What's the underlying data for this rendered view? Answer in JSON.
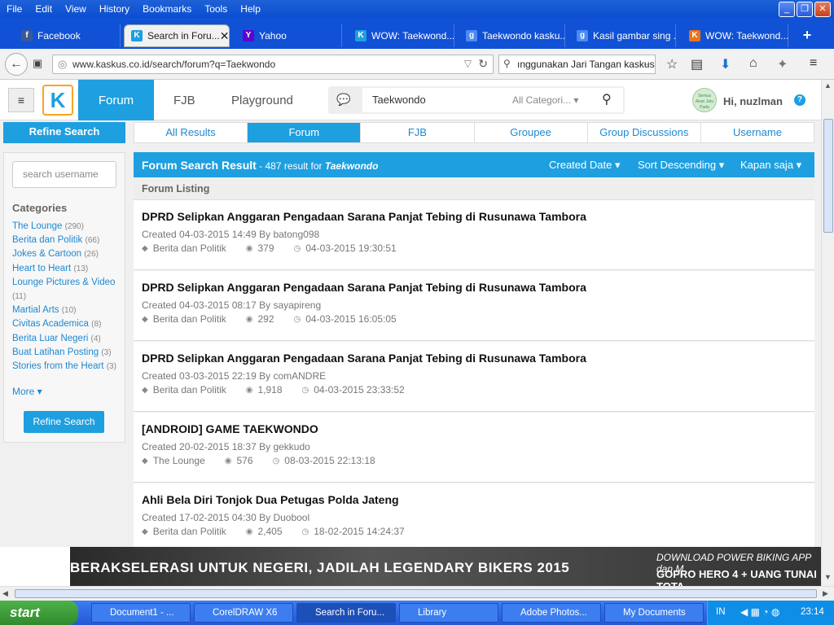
{
  "menubar": [
    "File",
    "Edit",
    "View",
    "History",
    "Bookmarks",
    "Tools",
    "Help"
  ],
  "tabs": [
    {
      "label": "Facebook",
      "icon": "facebook-icon"
    },
    {
      "label": "Search in Foru...",
      "icon": "kaskus-icon"
    },
    {
      "label": "Yahoo",
      "icon": "yahoo-icon"
    },
    {
      "label": "WOW: Taekwond...",
      "icon": "kaskus-icon"
    },
    {
      "label": "Taekwondo kasku...",
      "icon": "google-icon"
    },
    {
      "label": "Kasil gambar sing ...",
      "icon": "google-icon"
    },
    {
      "label": "WOW: Taekwond...",
      "icon": "kaskus-icon"
    }
  ],
  "url": "www.kaskus.co.id/search/forum?q=Taekwondo",
  "browser_search": "ınggunakan Jari Tangan kaskus",
  "header": {
    "nav_forum": "Forum",
    "nav_fjb": "FJB",
    "nav_playground": "Playground",
    "search_value": "Taekwondo",
    "category": "All Categori...",
    "greeting": "Hi, nuzlman",
    "help": "?",
    "avatar_text": "Semua Akan Jatu Pada Waktunya"
  },
  "sidebar": {
    "refine_head": "Refine Search",
    "username_placeholder": "search username",
    "categories_label": "Categories",
    "categories": [
      {
        "name": "The Lounge",
        "count": "(290)"
      },
      {
        "name": "Berita dan Politik",
        "count": "(66)"
      },
      {
        "name": "Jokes & Cartoon",
        "count": "(26)"
      },
      {
        "name": "Heart to Heart",
        "count": "(13)"
      },
      {
        "name": "Lounge Pictures & Video",
        "count": "(11)"
      },
      {
        "name": "Martial Arts",
        "count": "(10)"
      },
      {
        "name": "Civitas Academica",
        "count": "(8)"
      },
      {
        "name": "Berita Luar Negeri",
        "count": "(4)"
      },
      {
        "name": "Buat Latihan Posting",
        "count": "(3)"
      },
      {
        "name": "Stories from the Heart",
        "count": "(3)"
      }
    ],
    "more": "More ▾",
    "refine_button": "Refine Search"
  },
  "search_tabs": [
    "All Results",
    "Forum",
    "FJB",
    "Groupee",
    "Group Discussions",
    "Username"
  ],
  "result_header": {
    "title": "Forum Search Result",
    "count_text": " - 487 result for ",
    "query": "Taekwondo",
    "sort1": "Created Date",
    "sort2": "Sort Descending",
    "sort3": "Kapan saja"
  },
  "listing_label": "Forum Listing",
  "results": [
    {
      "title": "DPRD Selipkan Anggaran Pengadaan Sarana Panjat Tebing di Rusunawa Tambora",
      "created": "Created 04-03-2015 14:49 By batong098",
      "category": "Berita dan Politik",
      "views": "379",
      "last": "04-03-2015 19:30:51"
    },
    {
      "title": "DPRD Selipkan Anggaran Pengadaan Sarana Panjat Tebing di Rusunawa Tambora",
      "created": "Created 04-03-2015 08:17 By sayapireng",
      "category": "Berita dan Politik",
      "views": "292",
      "last": "04-03-2015 16:05:05"
    },
    {
      "title": "DPRD Selipkan Anggaran Pengadaan Sarana Panjat Tebing di Rusunawa Tambora",
      "created": "Created 03-03-2015 22:19 By comANDRE",
      "category": "Berita dan Politik",
      "views": "1,918",
      "last": "04-03-2015 23:33:52"
    },
    {
      "title": "[ANDROID] GAME TAEKWONDO",
      "created": "Created 20-02-2015 18:37 By gekkudo",
      "category": "The Lounge",
      "views": "576",
      "last": "08-03-2015 22:13:18"
    },
    {
      "title": "Ahli Bela Diri Tonjok Dua Petugas Polda Jateng",
      "created": "Created 17-02-2015 04:30 By Duobool",
      "category": "Berita dan Politik",
      "views": "2,405",
      "last": "18-02-2015 14:24:37"
    }
  ],
  "banner": {
    "left": "BERAKSELERASI UNTUK NEGERI, JADILAH LEGENDARY BIKERS 2015",
    "right1": "DOWNLOAD POWER BIKING APP dan M",
    "right2": "GOPRO HERO 4 + UANG TUNAI TOTA"
  },
  "taskbar": {
    "start": "start",
    "items": [
      "Document1 - ...",
      "CorelDRAW X6",
      "Search in Foru...",
      "Library",
      "Adobe Photos...",
      "My Documents"
    ],
    "lang": "IN",
    "clock": "23:14"
  }
}
